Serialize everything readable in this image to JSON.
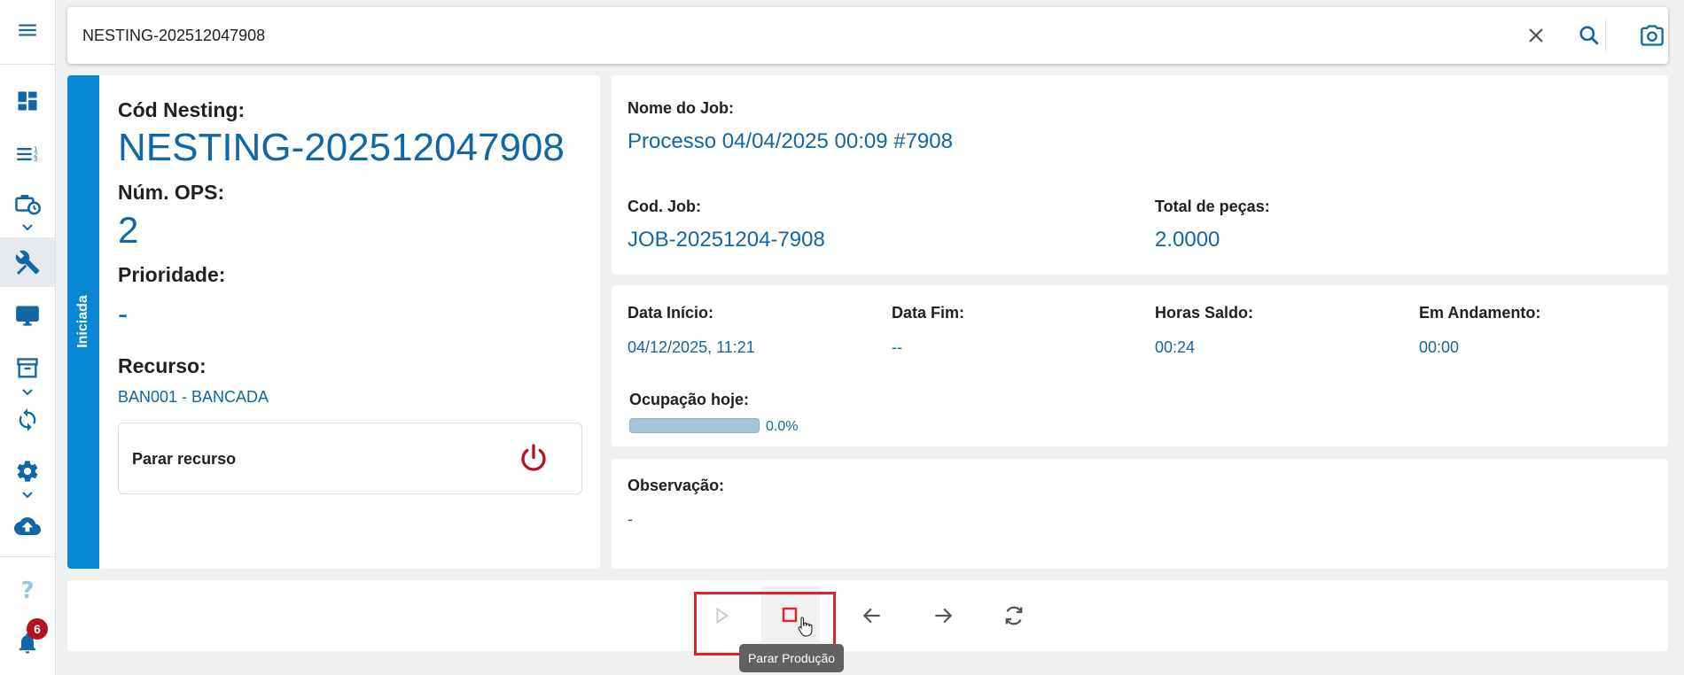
{
  "sidebar": {
    "items": [
      {
        "icon": "menu-icon"
      },
      {
        "icon": "dashboard-icon"
      },
      {
        "icon": "list-numbered-icon"
      },
      {
        "icon": "briefcase-clock-icon"
      },
      {
        "icon": "tools-icon",
        "active": true
      },
      {
        "icon": "monitor-icon"
      },
      {
        "icon": "archive-box-icon"
      },
      {
        "icon": "sync-icon"
      },
      {
        "icon": "gear-icon"
      },
      {
        "icon": "cloud-upload-icon"
      },
      {
        "icon": "help-icon"
      },
      {
        "icon": "bell-icon"
      }
    ],
    "notification_count": "6"
  },
  "search": {
    "value": "NESTING-202512047908",
    "placeholder": ""
  },
  "nesting": {
    "status": "Iniciada",
    "cod_label": "Cód Nesting:",
    "cod_value": "NESTING-202512047908",
    "ops_label": "Núm. OPS:",
    "ops_value": "2",
    "prioridade_label": "Prioridade:",
    "prioridade_value": "-",
    "recurso_label": "Recurso:",
    "recurso_value": "BAN001 - BANCADA",
    "parar_recurso_label": "Parar recurso"
  },
  "job": {
    "nome_label": "Nome do Job:",
    "nome_value": "Processo 04/04/2025 00:09 #7908",
    "cod_label": "Cod. Job:",
    "cod_value": "JOB-20251204-7908",
    "total_label": "Total de peças:",
    "total_value": "2.0000"
  },
  "times": {
    "inicio_label": "Data Início:",
    "inicio_value": "04/12/2025, 11:21",
    "fim_label": "Data Fim:",
    "fim_value": "--",
    "saldo_label": "Horas Saldo:",
    "saldo_value": "00:24",
    "andamento_label": "Em Andamento:",
    "andamento_value": "00:00",
    "ocupacao_label": "Ocupação hoje:",
    "ocupacao_value": "0.0%",
    "ocupacao_fraction": 0.0
  },
  "observacao": {
    "label": "Observação:",
    "value": "-"
  },
  "toolbar": {
    "buttons": [
      {
        "icon": "play-icon",
        "enabled": false
      },
      {
        "icon": "stop-icon",
        "enabled": true
      },
      {
        "icon": "arrow-left-icon",
        "enabled": true
      },
      {
        "icon": "arrow-right-icon",
        "enabled": true
      },
      {
        "icon": "refresh-icon",
        "enabled": true
      }
    ],
    "tooltip": "Parar Produção"
  },
  "colors": {
    "accent": "#1166a3",
    "status_strip": "#0a87d4",
    "power_icon": "#b3131e",
    "highlight": "#e0222d",
    "badge": "#b3131e"
  }
}
